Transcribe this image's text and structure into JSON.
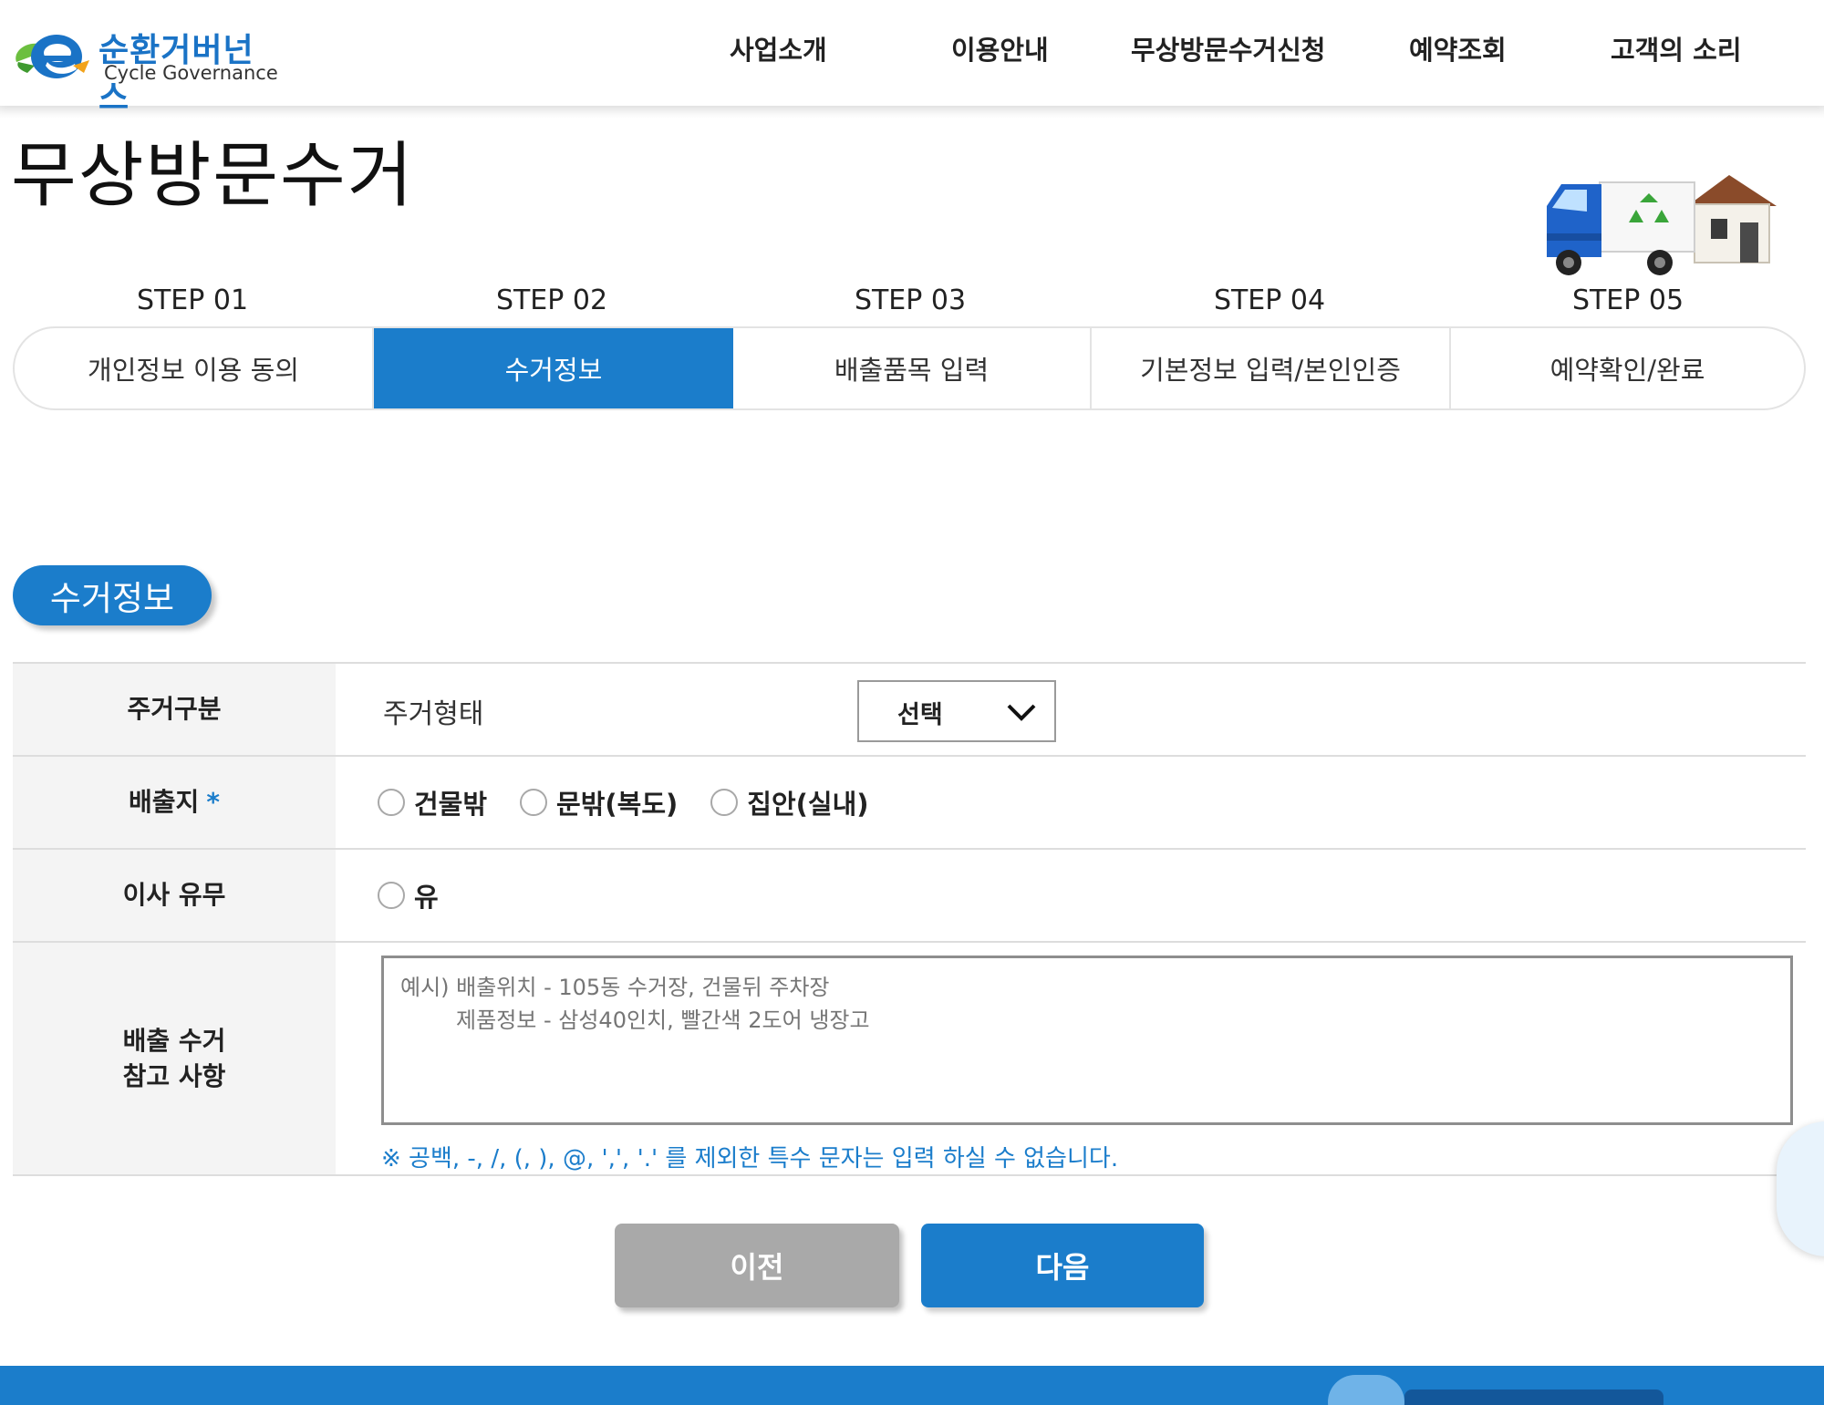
{
  "header": {
    "logo": {
      "name": "순환거버넌스",
      "subtitle": "Cycle Governance"
    },
    "nav": [
      "사업소개",
      "이용안내",
      "무상방문수거신청",
      "예약조회",
      "고객의 소리"
    ]
  },
  "page": {
    "title": "무상방문수거"
  },
  "steps": [
    {
      "step": "STEP 01",
      "label": "개인정보 이용 동의",
      "active": false
    },
    {
      "step": "STEP 02",
      "label": "수거정보",
      "active": true
    },
    {
      "step": "STEP 03",
      "label": "배출품목 입력",
      "active": false
    },
    {
      "step": "STEP 04",
      "label": "기본정보 입력/본인인증",
      "active": false
    },
    {
      "step": "STEP 05",
      "label": "예약확인/완료",
      "active": false
    }
  ],
  "section": {
    "title": "수거정보"
  },
  "form": {
    "housing": {
      "header": "주거구분",
      "field_label": "주거형태",
      "select_value": "선택"
    },
    "location": {
      "header": "배출지",
      "required_mark": "*",
      "options": [
        "건물밖",
        "문밖(복도)",
        "집안(실내)"
      ]
    },
    "moving": {
      "header": "이사 유무",
      "options": [
        "유"
      ]
    },
    "notes": {
      "header_line1": "배출 수거",
      "header_line2": "참고 사항",
      "placeholder": "예시) 배출위치 - 105동 수거장, 건물뒤 주차장\n        제품정보 - 삼성40인치, 빨간색 2도어 냉장고",
      "value": "",
      "notice": "※ 공백, -, /, (, ), @, ',', '.' 를 제외한 특수 문자는 입력 하실 수 없습니다."
    }
  },
  "buttons": {
    "prev": "이전",
    "next": "다음"
  },
  "colors": {
    "accent": "#1b7dcb",
    "prev_button": "#a9a9a9",
    "header_cell": "#f4f4f4"
  }
}
